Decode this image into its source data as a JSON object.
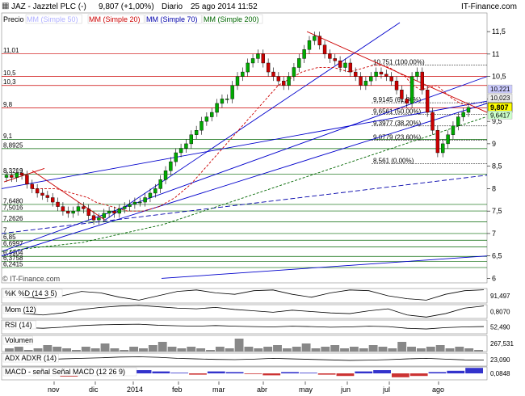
{
  "header": {
    "symbol": "JAZ - Jazztel PLC (-)",
    "last": "9,807 (+1,00%)",
    "period": "Diario",
    "datetime": "25 ago 2014 11:52",
    "brand": "IT-Finance.com"
  },
  "colors": {
    "bull": "#00aa00",
    "bear": "#cc0000",
    "sma20": "#cc0000",
    "sma50": "#b0b0ff",
    "sma70": "#0000aa",
    "sma200": "#006600",
    "fib": "#000000",
    "trend_red": "#cc0000",
    "trend_blue": "#0000cc"
  },
  "chart_data": [
    {
      "type": "line",
      "title": "JAZ - Jazztel PLC (-)",
      "ylim": [
        5.9,
        11.7
      ],
      "x_tick_labels": [
        "nov",
        "dic",
        "2014",
        "feb",
        "mar",
        "abr",
        "may",
        "jun",
        "jul",
        "ago"
      ],
      "y_tick_labels": [
        "11,5",
        "11",
        "10,5",
        "10",
        "9,5",
        "9",
        "8,5",
        "8",
        "7,5",
        "7",
        "6,5",
        "6"
      ],
      "legend": [
        "Precio",
        "MM (Simple 50)",
        "MM (Simple 20)",
        "MM (Simple 70)",
        "MM (Simple 200)"
      ],
      "price_label": "9,807",
      "right_levels": [
        {
          "value": 10.221,
          "label": "10,221"
        },
        {
          "value": 10.023,
          "label": "10,023"
        },
        {
          "value": 9.6417,
          "label": "9,6417"
        }
      ],
      "left_levels": [
        {
          "value": 11.01,
          "label": "11,01"
        },
        {
          "value": 10.5,
          "label": "10,5"
        },
        {
          "value": 10.3,
          "label": "10,3"
        },
        {
          "value": 9.8,
          "label": "9,8"
        },
        {
          "value": 9.1,
          "label": "9,1"
        },
        {
          "value": 8.8925,
          "label": "8,8925"
        },
        {
          "value": 8.3219,
          "label": "8,3219"
        },
        {
          "value": 7.648,
          "label": "7,6480"
        },
        {
          "value": 7.5016,
          "label": "7,5016"
        },
        {
          "value": 7.2626,
          "label": "7,2626"
        },
        {
          "value": 7.0,
          "label": "7"
        },
        {
          "value": 6.85,
          "label": "6,85"
        },
        {
          "value": 6.6997,
          "label": "6,6997"
        },
        {
          "value": 6.4904,
          "label": "6,4904"
        },
        {
          "value": 6.3758,
          "label": "6,3758"
        },
        {
          "value": 6.2415,
          "label": "6,2415"
        }
      ],
      "fib_levels": [
        {
          "value": 10.751,
          "label": "10,751 (100,00%)"
        },
        {
          "value": 9.9145,
          "label": "9,9145 (61,80%)"
        },
        {
          "value": 9.6561,
          "label": "9,6561 (50,00%)"
        },
        {
          "value": 9.3977,
          "label": "9,3977 (38,20%)"
        },
        {
          "value": 9.0779,
          "label": "9,0779 (23,60%)"
        },
        {
          "value": 8.561,
          "label": "8,561 (0,00%)"
        }
      ],
      "close": [
        8.3,
        8.25,
        8.35,
        8.3,
        8.1,
        8.0,
        7.9,
        7.85,
        7.8,
        7.7,
        7.6,
        7.5,
        7.45,
        7.5,
        7.6,
        7.55,
        7.4,
        7.3,
        7.35,
        7.45,
        7.5,
        7.45,
        7.55,
        7.6,
        7.65,
        7.7,
        7.7,
        7.8,
        7.9,
        8.0,
        8.2,
        8.4,
        8.6,
        8.8,
        8.9,
        9.0,
        9.2,
        9.3,
        9.5,
        9.6,
        9.7,
        9.9,
        10.0,
        10.0,
        10.3,
        10.5,
        10.6,
        10.8,
        10.9,
        11.0,
        10.8,
        10.6,
        10.5,
        10.4,
        10.3,
        10.5,
        10.7,
        10.9,
        11.1,
        11.3,
        11.4,
        11.2,
        11.0,
        10.9,
        10.85,
        10.7,
        10.8,
        10.6,
        10.5,
        10.3,
        10.4,
        10.5,
        10.6,
        10.55,
        10.5,
        10.4,
        10.2,
        10.0,
        9.9,
        10.5,
        10.6,
        10.2,
        9.7,
        9.3,
        8.8,
        9.0,
        9.2,
        9.4,
        9.6,
        9.7,
        9.81
      ],
      "sma20": [
        8.0,
        8.0,
        8.0,
        8.0,
        7.95,
        7.9,
        7.85,
        7.8,
        7.7,
        7.65,
        7.6,
        7.55,
        7.5,
        7.5,
        7.5,
        7.55,
        7.6,
        7.7,
        7.8,
        7.95,
        8.1,
        8.3,
        8.5,
        8.7,
        8.9,
        9.1,
        9.3,
        9.5,
        9.7,
        9.9,
        10.1,
        10.3,
        10.4,
        10.5,
        10.6,
        10.65,
        10.7,
        10.7,
        10.7,
        10.65,
        10.6,
        10.65,
        10.7,
        10.75,
        10.75,
        10.7,
        10.6,
        10.5,
        10.3,
        10.2,
        10.25,
        10.3,
        10.15,
        10.0,
        9.9,
        9.85
      ],
      "sma200": [
        6.6,
        6.65,
        6.7,
        6.75,
        6.8,
        6.9,
        7.0,
        7.1,
        7.2,
        7.35,
        7.5,
        7.65,
        7.8,
        7.95,
        8.1,
        8.25,
        8.4,
        8.55,
        8.7,
        8.85,
        9.0,
        9.15,
        9.3,
        9.45,
        9.6
      ]
    },
    {
      "type": "line",
      "title": "%K  %D (14 3 5)",
      "series": [
        {
          "name": "%K",
          "values": [
            60,
            40,
            30,
            50,
            80,
            70,
            40,
            20,
            50,
            80,
            90,
            70,
            60,
            85,
            90,
            60,
            40,
            70,
            90,
            85,
            50,
            30,
            20,
            60,
            85,
            91
          ]
        }
      ],
      "last_label": "91,497"
    },
    {
      "type": "line",
      "title": "Mom (12)",
      "series": [
        {
          "name": "Mom",
          "values": [
            0.2,
            -0.3,
            -0.5,
            -0.2,
            0.3,
            0.6,
            0.8,
            0.9,
            0.7,
            0.5,
            0.4,
            0.6,
            0.3,
            0.1,
            -0.1,
            0.2,
            0.0,
            -0.2,
            -0.3,
            0.1,
            0.4,
            -0.5,
            -0.8,
            -0.3,
            0.5,
            0.81
          ]
        }
      ],
      "last_label": "0,8070"
    },
    {
      "type": "line",
      "title": "RSI (14)",
      "series": [
        {
          "name": "RSI",
          "values": [
            55,
            45,
            40,
            48,
            60,
            65,
            68,
            70,
            62,
            58,
            55,
            60,
            55,
            52,
            50,
            55,
            52,
            48,
            50,
            55,
            52,
            40,
            35,
            45,
            50,
            52.49
          ]
        }
      ],
      "last_label": "52,490"
    },
    {
      "type": "bar",
      "title": "Volumen",
      "values": [
        2,
        3,
        1,
        2,
        4,
        3,
        2,
        1,
        3,
        2,
        5,
        2,
        1,
        3,
        2,
        4,
        6,
        3,
        2,
        3,
        2,
        1,
        3,
        2,
        8,
        3,
        2,
        3,
        4,
        2,
        3,
        5,
        2,
        3,
        4,
        2,
        3,
        2,
        4,
        3,
        2,
        6,
        3,
        2,
        3,
        4,
        2,
        3,
        2,
        1
      ],
      "last_label": "267,531"
    },
    {
      "type": "line",
      "title": "ADX  ADXR (14)",
      "series": [
        {
          "name": "ADX",
          "values": [
            20,
            22,
            25,
            28,
            30,
            32,
            35,
            36,
            34,
            30,
            28,
            26,
            25,
            27,
            30,
            28,
            26,
            24,
            22,
            23,
            25,
            28,
            30,
            27,
            24,
            23.09
          ]
        }
      ],
      "last_label": "23,090"
    },
    {
      "type": "bar",
      "title": "MACD - señal  Señal  MACD (12 26 9)",
      "values": [
        0.05,
        0.02,
        -0.03,
        -0.05,
        0.02,
        0.06,
        0.08,
        0.05,
        0.03,
        0.01,
        -0.02,
        0.03,
        0.02,
        -0.01,
        -0.03,
        0.02,
        0.01,
        -0.02,
        -0.04,
        0.03,
        0.05,
        -0.06,
        -0.04,
        0.02,
        0.04,
        0.0848
      ],
      "last_label": "0,0848"
    }
  ],
  "footer": {
    "watermark": "© IT-Finance.com"
  }
}
